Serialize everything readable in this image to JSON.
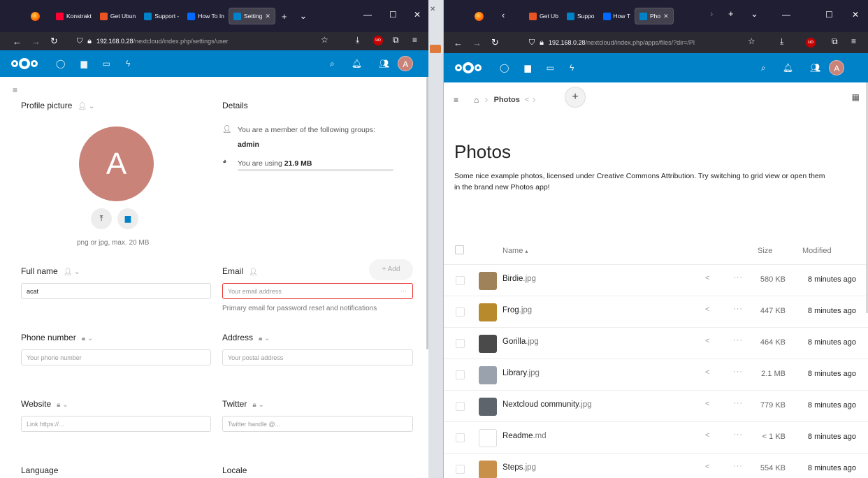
{
  "left": {
    "tabs": [
      {
        "label": "Konstrakt",
        "fav": "#ff0033"
      },
      {
        "label": "Get Ubun",
        "fav": "#e95420"
      },
      {
        "label": "Support -",
        "fav": "#0082c9"
      },
      {
        "label": "How To In",
        "fav": "#0069ff"
      },
      {
        "label": "Setting",
        "fav": "#0082c9",
        "active": true
      }
    ],
    "url_host": "192.168.0.28",
    "url_path": "/nextcloud/index.php/settings/user",
    "profile_label": "Profile picture",
    "avatar_letter": "A",
    "upload_hint": "png or jpg, max. 20 MB",
    "details_label": "Details",
    "groups_text": "You are a member of the following groups:",
    "group_name": "admin",
    "usage_prefix": "You are using ",
    "usage_value": "21.9 MB",
    "fullname_label": "Full name",
    "fullname_value": "acat",
    "email_label": "Email",
    "add_label": "Add",
    "email_placeholder": "Your email address",
    "email_hint": "Primary email for password reset and notifications",
    "phone_label": "Phone number",
    "phone_placeholder": "Your phone number",
    "address_label": "Address",
    "address_placeholder": "Your postal address",
    "website_label": "Website",
    "website_placeholder": "Link https://...",
    "twitter_label": "Twitter",
    "twitter_placeholder": "Twitter handle @...",
    "language_label": "Language",
    "locale_label": "Locale"
  },
  "right": {
    "tabs": [
      {
        "label": "Get Ub",
        "fav": "#e95420"
      },
      {
        "label": "Suppo",
        "fav": "#0082c9"
      },
      {
        "label": "How T",
        "fav": "#0069ff"
      },
      {
        "label": "Pho",
        "fav": "#0082c9",
        "active": true
      }
    ],
    "url_host": "192.168.0.28",
    "url_path": "/nextcloud/index.php/apps/files/?dir=/Pl",
    "avatar_letter": "A",
    "breadcrumb": "Photos",
    "title": "Photos",
    "description": "Some nice example photos, licensed under Creative Commons Attribution. Try switching to grid view or open them in the brand new Photos app!",
    "col_name": "Name",
    "col_size": "Size",
    "col_modified": "Modified",
    "files": [
      {
        "base": "Birdie",
        "ext": ".jpg",
        "size": "580 KB",
        "modified": "8 minutes ago",
        "thumb": "#a0825a"
      },
      {
        "base": "Frog",
        "ext": ".jpg",
        "size": "447 KB",
        "modified": "8 minutes ago",
        "thumb": "#b88a2c"
      },
      {
        "base": "Gorilla",
        "ext": ".jpg",
        "size": "464 KB",
        "modified": "8 minutes ago",
        "thumb": "#4a4a4a"
      },
      {
        "base": "Library",
        "ext": ".jpg",
        "size": "2.1 MB",
        "modified": "8 minutes ago",
        "thumb": "#9aa3ad"
      },
      {
        "base": "Nextcloud community",
        "ext": ".jpg",
        "size": "779 KB",
        "modified": "8 minutes ago",
        "thumb": "#5e646b"
      },
      {
        "base": "Readme",
        "ext": ".md",
        "size": "< 1 KB",
        "modified": "8 minutes ago",
        "thumb": "#ffffff"
      },
      {
        "base": "Steps",
        "ext": ".jpg",
        "size": "554 KB",
        "modified": "8 minutes ago",
        "thumb": "#c9904a"
      }
    ]
  }
}
